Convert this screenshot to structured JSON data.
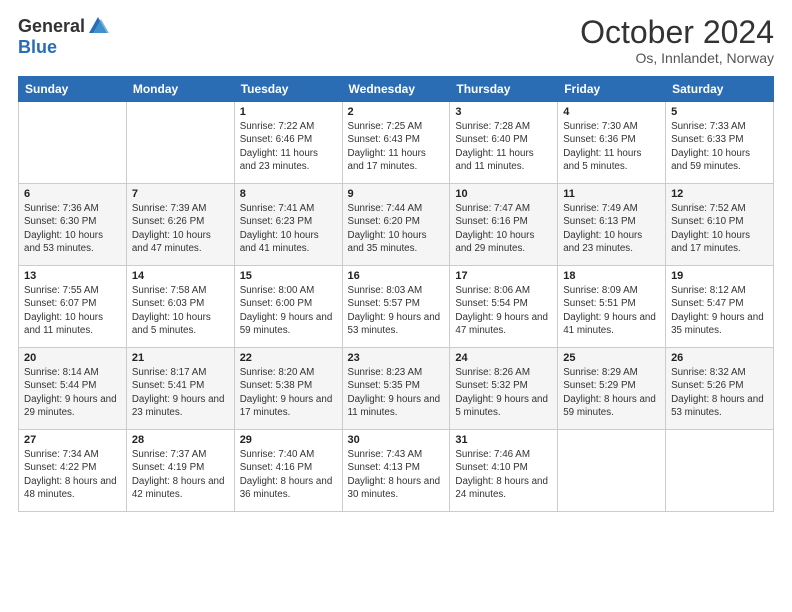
{
  "logo": {
    "general": "General",
    "blue": "Blue"
  },
  "title": "October 2024",
  "location": "Os, Innlandet, Norway",
  "days": [
    "Sunday",
    "Monday",
    "Tuesday",
    "Wednesday",
    "Thursday",
    "Friday",
    "Saturday"
  ],
  "weeks": [
    [
      {
        "date": "",
        "sunrise": "",
        "sunset": "",
        "daylight": ""
      },
      {
        "date": "",
        "sunrise": "",
        "sunset": "",
        "daylight": ""
      },
      {
        "date": "1",
        "sunrise": "Sunrise: 7:22 AM",
        "sunset": "Sunset: 6:46 PM",
        "daylight": "Daylight: 11 hours and 23 minutes."
      },
      {
        "date": "2",
        "sunrise": "Sunrise: 7:25 AM",
        "sunset": "Sunset: 6:43 PM",
        "daylight": "Daylight: 11 hours and 17 minutes."
      },
      {
        "date": "3",
        "sunrise": "Sunrise: 7:28 AM",
        "sunset": "Sunset: 6:40 PM",
        "daylight": "Daylight: 11 hours and 11 minutes."
      },
      {
        "date": "4",
        "sunrise": "Sunrise: 7:30 AM",
        "sunset": "Sunset: 6:36 PM",
        "daylight": "Daylight: 11 hours and 5 minutes."
      },
      {
        "date": "5",
        "sunrise": "Sunrise: 7:33 AM",
        "sunset": "Sunset: 6:33 PM",
        "daylight": "Daylight: 10 hours and 59 minutes."
      }
    ],
    [
      {
        "date": "6",
        "sunrise": "Sunrise: 7:36 AM",
        "sunset": "Sunset: 6:30 PM",
        "daylight": "Daylight: 10 hours and 53 minutes."
      },
      {
        "date": "7",
        "sunrise": "Sunrise: 7:39 AM",
        "sunset": "Sunset: 6:26 PM",
        "daylight": "Daylight: 10 hours and 47 minutes."
      },
      {
        "date": "8",
        "sunrise": "Sunrise: 7:41 AM",
        "sunset": "Sunset: 6:23 PM",
        "daylight": "Daylight: 10 hours and 41 minutes."
      },
      {
        "date": "9",
        "sunrise": "Sunrise: 7:44 AM",
        "sunset": "Sunset: 6:20 PM",
        "daylight": "Daylight: 10 hours and 35 minutes."
      },
      {
        "date": "10",
        "sunrise": "Sunrise: 7:47 AM",
        "sunset": "Sunset: 6:16 PM",
        "daylight": "Daylight: 10 hours and 29 minutes."
      },
      {
        "date": "11",
        "sunrise": "Sunrise: 7:49 AM",
        "sunset": "Sunset: 6:13 PM",
        "daylight": "Daylight: 10 hours and 23 minutes."
      },
      {
        "date": "12",
        "sunrise": "Sunrise: 7:52 AM",
        "sunset": "Sunset: 6:10 PM",
        "daylight": "Daylight: 10 hours and 17 minutes."
      }
    ],
    [
      {
        "date": "13",
        "sunrise": "Sunrise: 7:55 AM",
        "sunset": "Sunset: 6:07 PM",
        "daylight": "Daylight: 10 hours and 11 minutes."
      },
      {
        "date": "14",
        "sunrise": "Sunrise: 7:58 AM",
        "sunset": "Sunset: 6:03 PM",
        "daylight": "Daylight: 10 hours and 5 minutes."
      },
      {
        "date": "15",
        "sunrise": "Sunrise: 8:00 AM",
        "sunset": "Sunset: 6:00 PM",
        "daylight": "Daylight: 9 hours and 59 minutes."
      },
      {
        "date": "16",
        "sunrise": "Sunrise: 8:03 AM",
        "sunset": "Sunset: 5:57 PM",
        "daylight": "Daylight: 9 hours and 53 minutes."
      },
      {
        "date": "17",
        "sunrise": "Sunrise: 8:06 AM",
        "sunset": "Sunset: 5:54 PM",
        "daylight": "Daylight: 9 hours and 47 minutes."
      },
      {
        "date": "18",
        "sunrise": "Sunrise: 8:09 AM",
        "sunset": "Sunset: 5:51 PM",
        "daylight": "Daylight: 9 hours and 41 minutes."
      },
      {
        "date": "19",
        "sunrise": "Sunrise: 8:12 AM",
        "sunset": "Sunset: 5:47 PM",
        "daylight": "Daylight: 9 hours and 35 minutes."
      }
    ],
    [
      {
        "date": "20",
        "sunrise": "Sunrise: 8:14 AM",
        "sunset": "Sunset: 5:44 PM",
        "daylight": "Daylight: 9 hours and 29 minutes."
      },
      {
        "date": "21",
        "sunrise": "Sunrise: 8:17 AM",
        "sunset": "Sunset: 5:41 PM",
        "daylight": "Daylight: 9 hours and 23 minutes."
      },
      {
        "date": "22",
        "sunrise": "Sunrise: 8:20 AM",
        "sunset": "Sunset: 5:38 PM",
        "daylight": "Daylight: 9 hours and 17 minutes."
      },
      {
        "date": "23",
        "sunrise": "Sunrise: 8:23 AM",
        "sunset": "Sunset: 5:35 PM",
        "daylight": "Daylight: 9 hours and 11 minutes."
      },
      {
        "date": "24",
        "sunrise": "Sunrise: 8:26 AM",
        "sunset": "Sunset: 5:32 PM",
        "daylight": "Daylight: 9 hours and 5 minutes."
      },
      {
        "date": "25",
        "sunrise": "Sunrise: 8:29 AM",
        "sunset": "Sunset: 5:29 PM",
        "daylight": "Daylight: 8 hours and 59 minutes."
      },
      {
        "date": "26",
        "sunrise": "Sunrise: 8:32 AM",
        "sunset": "Sunset: 5:26 PM",
        "daylight": "Daylight: 8 hours and 53 minutes."
      }
    ],
    [
      {
        "date": "27",
        "sunrise": "Sunrise: 7:34 AM",
        "sunset": "Sunset: 4:22 PM",
        "daylight": "Daylight: 8 hours and 48 minutes."
      },
      {
        "date": "28",
        "sunrise": "Sunrise: 7:37 AM",
        "sunset": "Sunset: 4:19 PM",
        "daylight": "Daylight: 8 hours and 42 minutes."
      },
      {
        "date": "29",
        "sunrise": "Sunrise: 7:40 AM",
        "sunset": "Sunset: 4:16 PM",
        "daylight": "Daylight: 8 hours and 36 minutes."
      },
      {
        "date": "30",
        "sunrise": "Sunrise: 7:43 AM",
        "sunset": "Sunset: 4:13 PM",
        "daylight": "Daylight: 8 hours and 30 minutes."
      },
      {
        "date": "31",
        "sunrise": "Sunrise: 7:46 AM",
        "sunset": "Sunset: 4:10 PM",
        "daylight": "Daylight: 8 hours and 24 minutes."
      },
      {
        "date": "",
        "sunrise": "",
        "sunset": "",
        "daylight": ""
      },
      {
        "date": "",
        "sunrise": "",
        "sunset": "",
        "daylight": ""
      }
    ]
  ]
}
